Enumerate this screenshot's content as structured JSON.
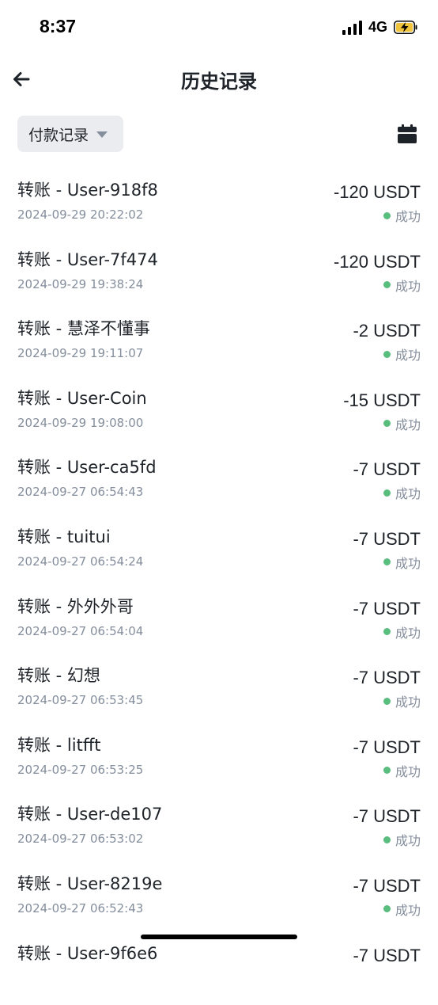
{
  "status_bar": {
    "time": "8:37",
    "network": "4G",
    "battery_color": "#f0c43a"
  },
  "header": {
    "title": "历史记录",
    "back_icon": "arrow-left-icon"
  },
  "filter": {
    "selected": "付款记录",
    "calendar_icon": "calendar-icon"
  },
  "colors": {
    "success_dot": "#58bd7d",
    "secondary_text": "#848e9c",
    "primary_text": "#1e2329"
  },
  "records": [
    {
      "title": "转账 - User-918f8",
      "time": "2024-09-29 20:22:02",
      "amount": "-120 USDT",
      "status": "成功"
    },
    {
      "title": "转账 - User-7f474",
      "time": "2024-09-29 19:38:24",
      "amount": "-120 USDT",
      "status": "成功"
    },
    {
      "title": "转账 - 慧泽不懂事",
      "time": "2024-09-29 19:11:07",
      "amount": "-2 USDT",
      "status": "成功"
    },
    {
      "title": "转账 - User-Coin",
      "time": "2024-09-29 19:08:00",
      "amount": "-15 USDT",
      "status": "成功"
    },
    {
      "title": "转账 - User-ca5fd",
      "time": "2024-09-27 06:54:43",
      "amount": "-7 USDT",
      "status": "成功"
    },
    {
      "title": "转账 - tuitui",
      "time": "2024-09-27 06:54:24",
      "amount": "-7 USDT",
      "status": "成功"
    },
    {
      "title": "转账 - 外外外哥",
      "time": "2024-09-27 06:54:04",
      "amount": "-7 USDT",
      "status": "成功"
    },
    {
      "title": "转账 - 幻想",
      "time": "2024-09-27 06:53:45",
      "amount": "-7 USDT",
      "status": "成功"
    },
    {
      "title": "转账 - litfft",
      "time": "2024-09-27 06:53:25",
      "amount": "-7 USDT",
      "status": "成功"
    },
    {
      "title": "转账 - User-de107",
      "time": "2024-09-27 06:53:02",
      "amount": "-7 USDT",
      "status": "成功"
    },
    {
      "title": "转账 - User-8219e",
      "time": "2024-09-27 06:52:43",
      "amount": "-7 USDT",
      "status": "成功"
    },
    {
      "title": "转账 - User-9f6e6",
      "time": "",
      "amount": "-7 USDT",
      "status": ""
    }
  ]
}
